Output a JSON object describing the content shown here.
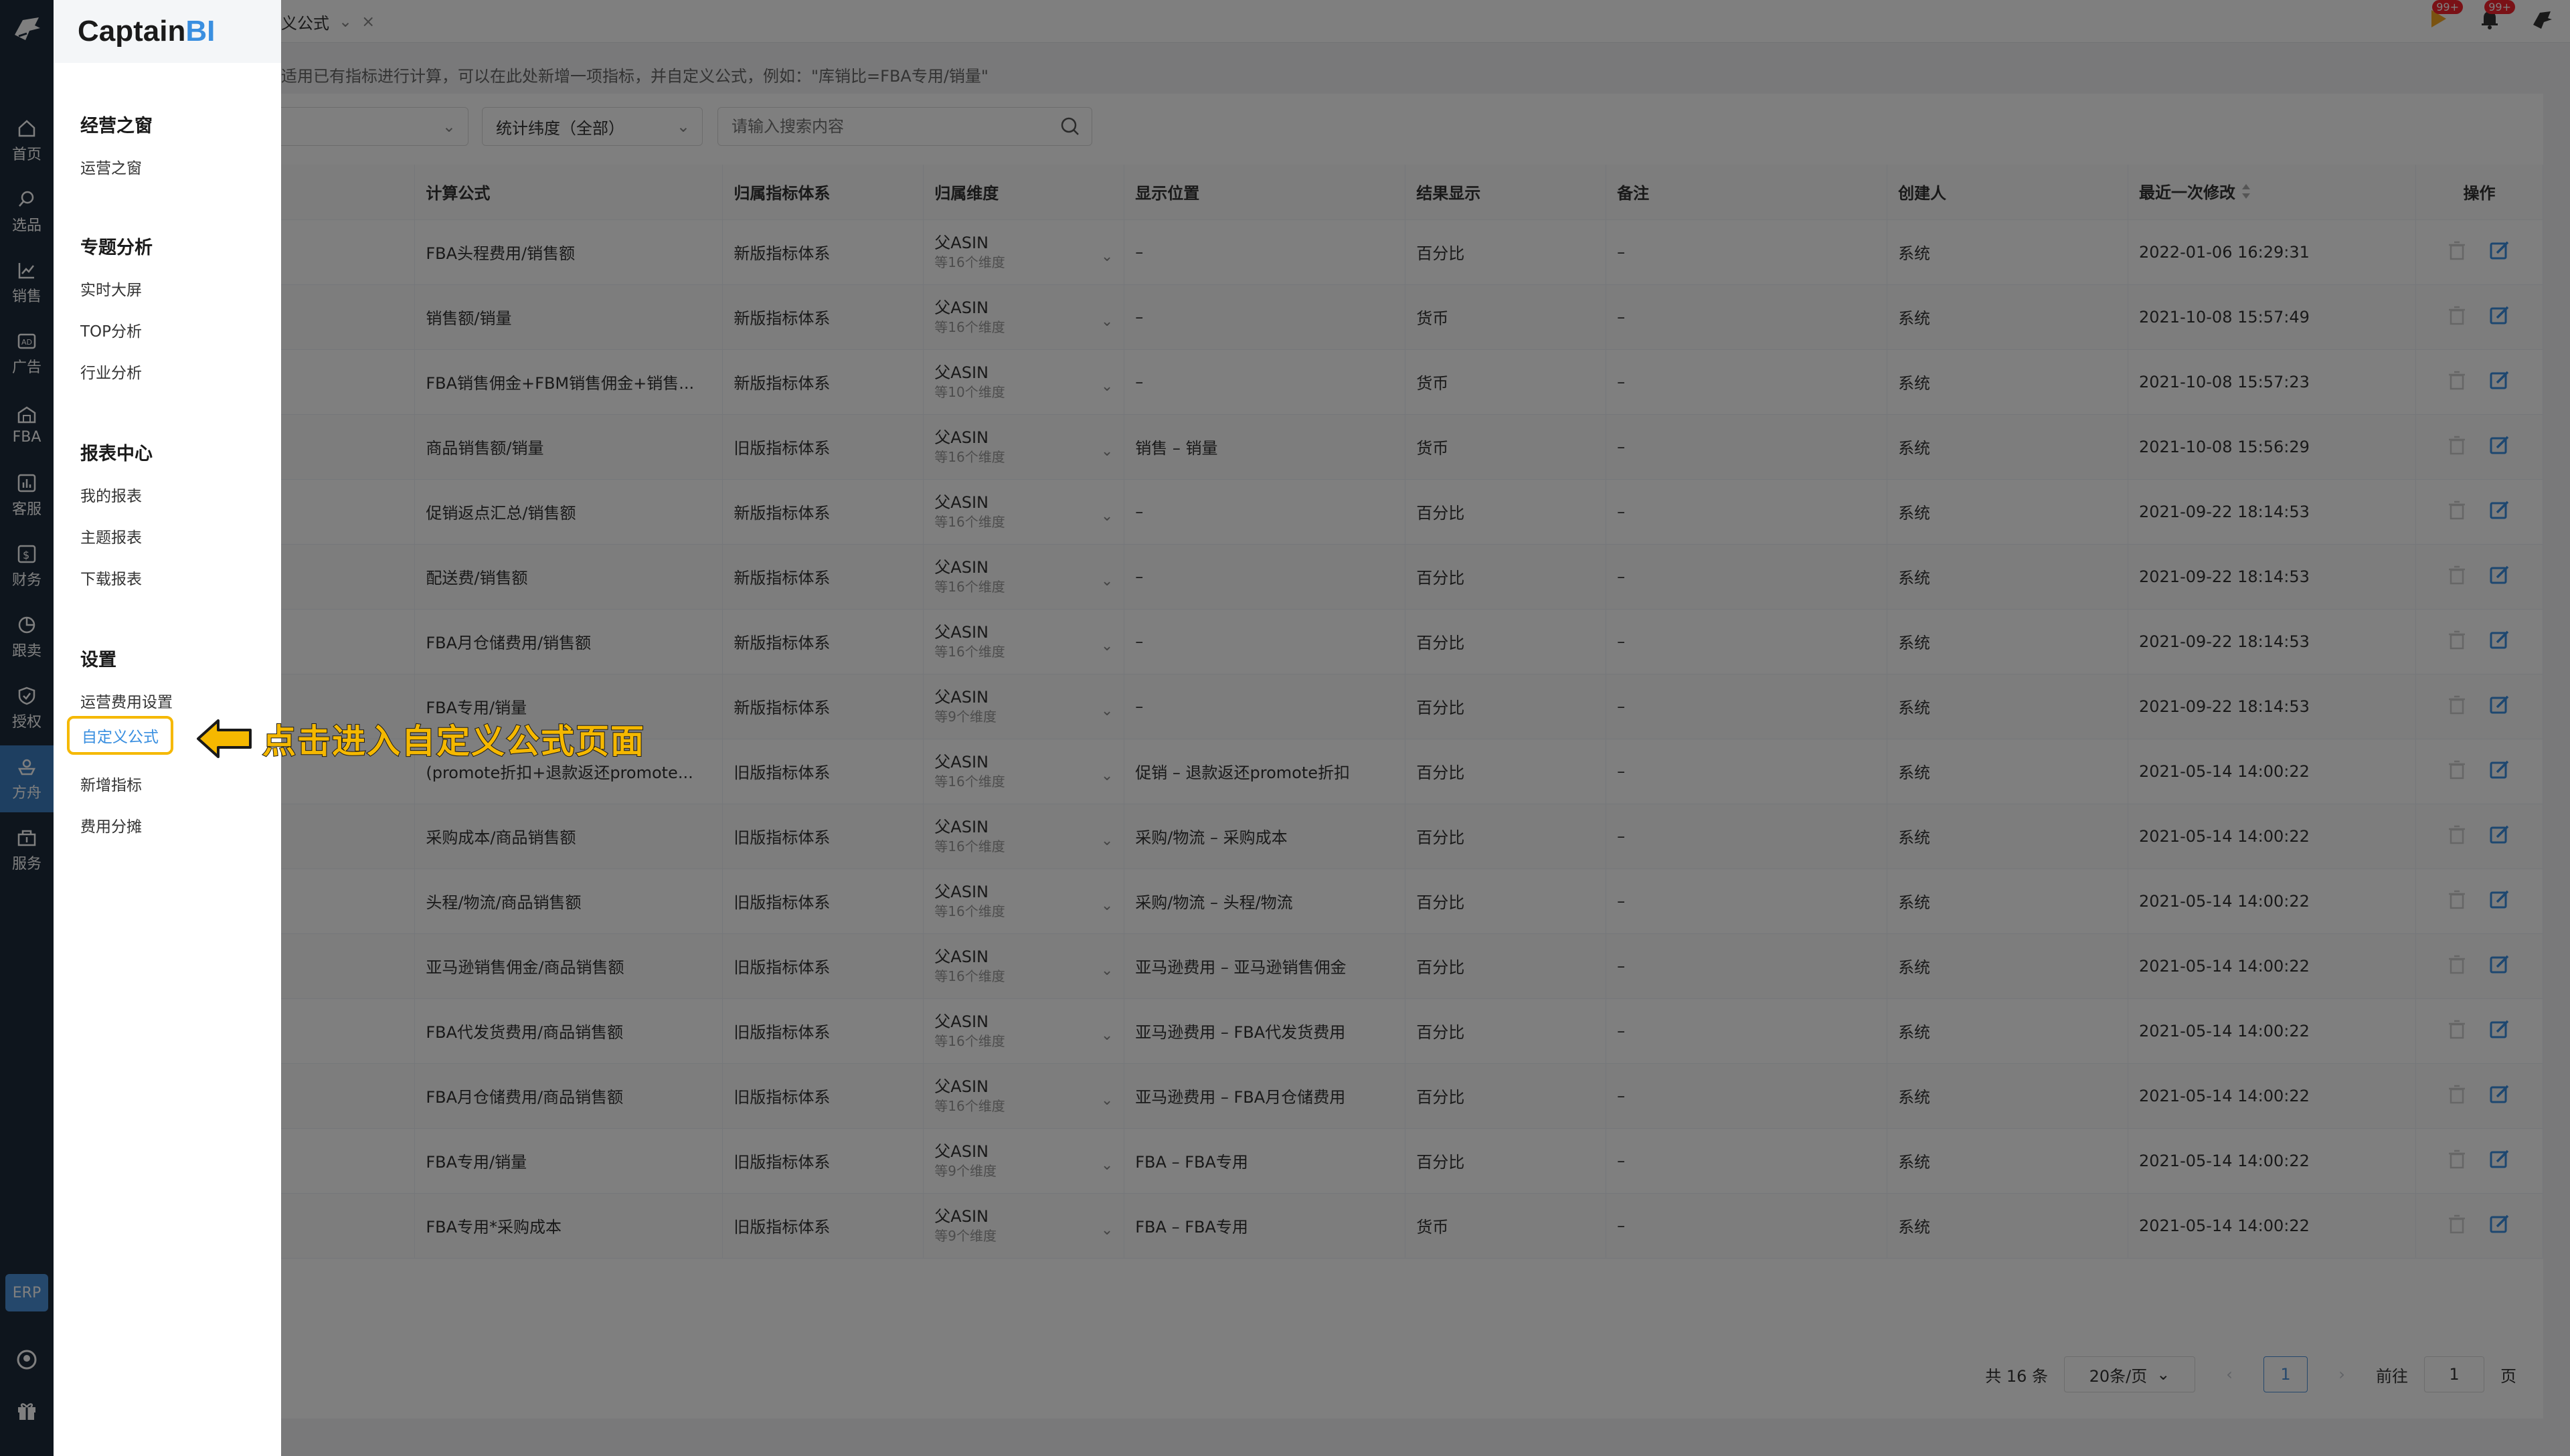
{
  "rail": {
    "items": [
      {
        "label": "首页",
        "icon": "home-icon"
      },
      {
        "label": "选品",
        "icon": "search-icon"
      },
      {
        "label": "销售",
        "icon": "trend-chart-icon"
      },
      {
        "label": "广告",
        "icon": "ad-icon"
      },
      {
        "label": "FBA",
        "icon": "warehouse-icon"
      },
      {
        "label": "客服",
        "icon": "bar-chart-icon"
      },
      {
        "label": "财务",
        "icon": "dollar-icon"
      },
      {
        "label": "跟卖",
        "icon": "pie-chart-icon"
      },
      {
        "label": "授权",
        "icon": "shield-check-icon"
      },
      {
        "label": "方舟",
        "icon": "ark-icon"
      },
      {
        "label": "服务",
        "icon": "service-icon"
      }
    ],
    "active_index": 9,
    "erp_label": "ERP"
  },
  "topbar": {
    "tab_label": "义公式",
    "notifications": [
      "99+",
      "99+"
    ]
  },
  "tip": "适用已有指标进行计算，可以在此处新增一项指标，并自定义公式，例如：\"库销比=FBA专用/销量\"",
  "filters": {
    "dimension_select": "统计纬度（全部）",
    "search_placeholder": "请输入搜索内容"
  },
  "table": {
    "headers": [
      "计算公式",
      "归属指标体系",
      "归属维度",
      "显示位置",
      "结果显示",
      "备注",
      "创建人",
      "最近一次修改",
      "操作"
    ],
    "rows": [
      {
        "formula": "FBA头程费用/销售额",
        "system": "新版指标体系",
        "dim_main": "父ASIN",
        "dim_sub": "等16个维度",
        "position": "–",
        "result": "百分比",
        "note": "–",
        "creator": "系统",
        "modified": "2022-01-06 16:29:31"
      },
      {
        "formula": "销售额/销量",
        "system": "新版指标体系",
        "dim_main": "父ASIN",
        "dim_sub": "等16个维度",
        "position": "–",
        "result": "货币",
        "note": "–",
        "creator": "系统",
        "modified": "2021-10-08 15:57:49"
      },
      {
        "formula": "FBA销售佣金+FBM销售佣金+销售...",
        "system": "新版指标体系",
        "dim_main": "父ASIN",
        "dim_sub": "等10个维度",
        "position": "–",
        "result": "货币",
        "note": "–",
        "creator": "系统",
        "modified": "2021-10-08 15:57:23"
      },
      {
        "formula": "商品销售额/销量",
        "system": "旧版指标体系",
        "dim_main": "父ASIN",
        "dim_sub": "等16个维度",
        "position": "销售 – 销量",
        "result": "货币",
        "note": "–",
        "creator": "系统",
        "modified": "2021-10-08 15:56:29"
      },
      {
        "formula": "促销返点汇总/销售额",
        "system": "新版指标体系",
        "dim_main": "父ASIN",
        "dim_sub": "等16个维度",
        "position": "–",
        "result": "百分比",
        "note": "–",
        "creator": "系统",
        "modified": "2021-09-22 18:14:53"
      },
      {
        "formula": "配送费/销售额",
        "system": "新版指标体系",
        "dim_main": "父ASIN",
        "dim_sub": "等16个维度",
        "position": "–",
        "result": "百分比",
        "note": "–",
        "creator": "系统",
        "modified": "2021-09-22 18:14:53"
      },
      {
        "formula": "FBA月仓储费用/销售额",
        "system": "新版指标体系",
        "dim_main": "父ASIN",
        "dim_sub": "等16个维度",
        "position": "–",
        "result": "百分比",
        "note": "–",
        "creator": "系统",
        "modified": "2021-09-22 18:14:53"
      },
      {
        "formula": "FBA专用/销量",
        "system": "新版指标体系",
        "dim_main": "父ASIN",
        "dim_sub": "等9个维度",
        "position": "–",
        "result": "百分比",
        "note": "–",
        "creator": "系统",
        "modified": "2021-09-22 18:14:53"
      },
      {
        "formula": "(promote折扣+退款返还promote...",
        "system": "旧版指标体系",
        "dim_main": "父ASIN",
        "dim_sub": "等16个维度",
        "position": "促销 – 退款返还promote折扣",
        "result": "百分比",
        "note": "–",
        "creator": "系统",
        "modified": "2021-05-14 14:00:22"
      },
      {
        "formula": "采购成本/商品销售额",
        "system": "旧版指标体系",
        "dim_main": "父ASIN",
        "dim_sub": "等16个维度",
        "position": "采购/物流 – 采购成本",
        "result": "百分比",
        "note": "–",
        "creator": "系统",
        "modified": "2021-05-14 14:00:22"
      },
      {
        "formula": "头程/物流/商品销售额",
        "system": "旧版指标体系",
        "dim_main": "父ASIN",
        "dim_sub": "等16个维度",
        "position": "采购/物流 – 头程/物流",
        "result": "百分比",
        "note": "–",
        "creator": "系统",
        "modified": "2021-05-14 14:00:22"
      },
      {
        "formula": "亚马逊销售佣金/商品销售额",
        "system": "旧版指标体系",
        "dim_main": "父ASIN",
        "dim_sub": "等16个维度",
        "position": "亚马逊费用 – 亚马逊销售佣金",
        "result": "百分比",
        "note": "–",
        "creator": "系统",
        "modified": "2021-05-14 14:00:22"
      },
      {
        "formula": "FBA代发货费用/商品销售额",
        "system": "旧版指标体系",
        "dim_main": "父ASIN",
        "dim_sub": "等16个维度",
        "position": "亚马逊费用 – FBA代发货费用",
        "result": "百分比",
        "note": "–",
        "creator": "系统",
        "modified": "2021-05-14 14:00:22"
      },
      {
        "formula": "FBA月仓储费用/商品销售额",
        "system": "旧版指标体系",
        "dim_main": "父ASIN",
        "dim_sub": "等16个维度",
        "position": "亚马逊费用 – FBA月仓储费用",
        "result": "百分比",
        "note": "–",
        "creator": "系统",
        "modified": "2021-05-14 14:00:22"
      },
      {
        "formula": "FBA专用/销量",
        "system": "旧版指标体系",
        "dim_main": "父ASIN",
        "dim_sub": "等9个维度",
        "position": "FBA – FBA专用",
        "result": "百分比",
        "note": "–",
        "creator": "系统",
        "modified": "2021-05-14 14:00:22"
      },
      {
        "formula": "FBA专用*采购成本",
        "system": "旧版指标体系",
        "dim_main": "父ASIN",
        "dim_sub": "等9个维度",
        "position": "FBA – FBA专用",
        "result": "货币",
        "note": "–",
        "creator": "系统",
        "modified": "2021-05-14 14:00:22"
      }
    ]
  },
  "pager": {
    "total": "共 16 条",
    "page_size": "20条/页",
    "current_page": "1",
    "goto_label": "前往",
    "goto_value": "1",
    "page_unit": "页"
  },
  "panel": {
    "logo_main": "Captain",
    "logo_accent": "BI",
    "groups": [
      {
        "title": "经营之窗",
        "items": [
          "运营之窗"
        ]
      },
      {
        "title": "专题分析",
        "items": [
          "实时大屏",
          "TOP分析",
          "行业分析"
        ]
      },
      {
        "title": "报表中心",
        "items": [
          "我的报表",
          "主题报表",
          "下载报表"
        ]
      },
      {
        "title": "设置",
        "items": [
          "运营费用设置",
          "自定义公式",
          "新增指标",
          "费用分摊"
        ]
      }
    ]
  },
  "annotation": "点击进入自定义公式页面",
  "colors": {
    "rail_bg": "#1c2a3a",
    "accent": "#3a8fe0",
    "highlight": "#f5b800"
  }
}
